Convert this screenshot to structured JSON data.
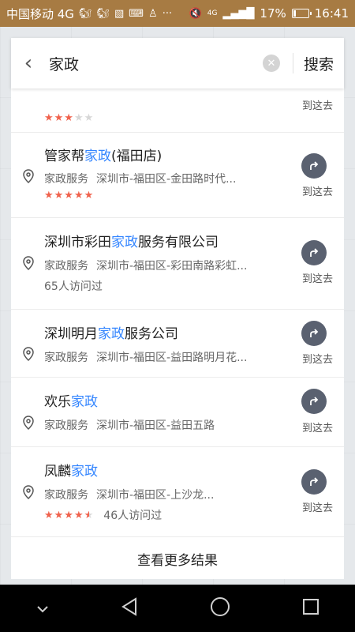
{
  "status_bar": {
    "carrier": "中国移动 4G",
    "right_signal_label": "4G",
    "battery_percent": "17%",
    "battery_level": 0.17,
    "time": "16:41",
    "icons": [
      "squirrel-icon",
      "squirrel-icon",
      "image-icon",
      "keyboard-icon",
      "broom-icon",
      "more-icon",
      "mute-icon",
      "signal-icon",
      "battery-icon"
    ]
  },
  "search": {
    "query": "家政",
    "button_label": "搜索"
  },
  "results": [
    {
      "title_pre": "",
      "title_hl": "",
      "title_post": "",
      "partial": true,
      "stars": 3,
      "route_label": "到这去"
    },
    {
      "title_pre": "管家帮",
      "title_hl": "家政",
      "title_post": "(福田店)",
      "category": "家政服务",
      "address": "深圳市-福田区-金田路时代...",
      "stars": 5,
      "route_label": "到这去"
    },
    {
      "title_pre": "深圳市彩田",
      "title_hl": "家政",
      "title_post": "服务有限公司",
      "category": "家政服务",
      "address": "深圳市-福田区-彩田南路彩虹...",
      "visits": "65人访问过",
      "route_label": "到这去"
    },
    {
      "title_pre": "深圳明月",
      "title_hl": "家政",
      "title_post": "服务公司",
      "category": "家政服务",
      "address": "深圳市-福田区-益田路明月花...",
      "route_label": "到这去"
    },
    {
      "title_pre": "欢乐",
      "title_hl": "家政",
      "title_post": "",
      "category": "家政服务",
      "address": "深圳市-福田区-益田五路",
      "route_label": "到这去"
    },
    {
      "title_pre": "凤麟",
      "title_hl": "家政",
      "title_post": "",
      "category": "家政服务",
      "address": "深圳市-福田区-上沙龙...",
      "stars": 4.5,
      "visits": "46人访问过",
      "route_label": "到这去"
    }
  ],
  "more_results_label": "查看更多结果",
  "colors": {
    "status_bar": "#a77b43",
    "highlight": "#3385ff",
    "star": "#f0624d",
    "route_button": "#5a6170"
  }
}
